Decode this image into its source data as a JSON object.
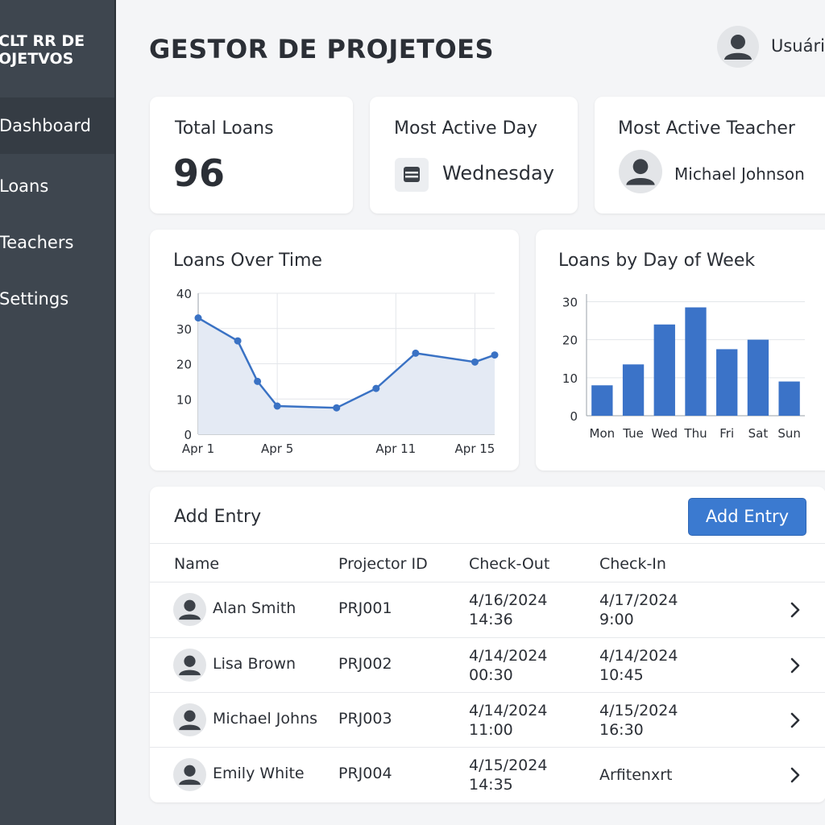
{
  "sidebar": {
    "brand_line1": "CLT RR DE",
    "brand_line2": "OJETVOS",
    "items": [
      {
        "label": "Dashboard",
        "active": true
      },
      {
        "label": "Loans",
        "active": false
      },
      {
        "label": "Teachers",
        "active": false
      },
      {
        "label": "Settings",
        "active": false
      }
    ]
  },
  "header": {
    "title": "GESTOR DE PROJETOES",
    "user_name": "Usuário"
  },
  "stats": {
    "total_loans_label": "Total Loans",
    "total_loans_value": "96",
    "active_day_label": "Most Active Day",
    "active_day_value": "Wednesday",
    "active_day_icon": "calendar-icon",
    "active_teacher_label": "Most Active Teacher",
    "active_teacher_value": "Michael Johnson"
  },
  "chart_data": [
    {
      "type": "area",
      "title": "Loans Over Time",
      "xlabel": "",
      "ylabel": "",
      "x_tick_labels": [
        "Apr 1",
        "Apr 5",
        "Apr 11",
        "Apr 15"
      ],
      "y_ticks": [
        0,
        10,
        20,
        30,
        40
      ],
      "ylim": [
        0,
        40
      ],
      "grid": true,
      "color": "#3a72c4",
      "fill": "#e4eaf4",
      "points": [
        {
          "x": "Apr 1",
          "y": 33
        },
        {
          "x": "Apr 3",
          "y": 26.5
        },
        {
          "x": "Apr 4",
          "y": 15
        },
        {
          "x": "Apr 5",
          "y": 8
        },
        {
          "x": "Apr 8",
          "y": 7.5
        },
        {
          "x": "Apr 10",
          "y": 13
        },
        {
          "x": "Apr 12",
          "y": 23
        },
        {
          "x": "Apr 15",
          "y": 20.5
        },
        {
          "x": "Apr 16",
          "y": 22.5
        }
      ]
    },
    {
      "type": "bar",
      "title": "Loans by Day of Week",
      "xlabel": "",
      "ylabel": "",
      "categories": [
        "Mon",
        "Tue",
        "Wed",
        "Thu",
        "Fri",
        "Sat",
        "Sun"
      ],
      "values": [
        8,
        13.5,
        24,
        28.5,
        17.5,
        20,
        9
      ],
      "y_ticks": [
        0,
        10,
        20,
        30
      ],
      "ylim": [
        0,
        32
      ],
      "grid": true,
      "color": "#3b73c8"
    }
  ],
  "table": {
    "title": "Add Entry",
    "button_label": "Add Entry",
    "columns": [
      "Name",
      "Projector ID",
      "Check-Out",
      "Check-In"
    ],
    "rows": [
      {
        "name": "Alan Smith",
        "id": "PRJ001",
        "out_date": "4/16/2024",
        "out_time": "14:36",
        "in_date": "4/17/2024",
        "in_time": "9:00"
      },
      {
        "name": "Lisa Brown",
        "id": "PRJ002",
        "out_date": "4/14/2024",
        "out_time": "00:30",
        "in_date": "4/14/2024",
        "in_time": "10:45"
      },
      {
        "name": "Michael Johns",
        "id": "PRJ003",
        "out_date": "4/14/2024",
        "out_time": "11:00",
        "in_date": "4/15/2024",
        "in_time": "16:30"
      },
      {
        "name": "Emily White",
        "id": "PRJ004",
        "out_date": "4/15/2024",
        "out_time": "14:35",
        "in_date": "Arfitenxrt",
        "in_time": ""
      }
    ]
  }
}
